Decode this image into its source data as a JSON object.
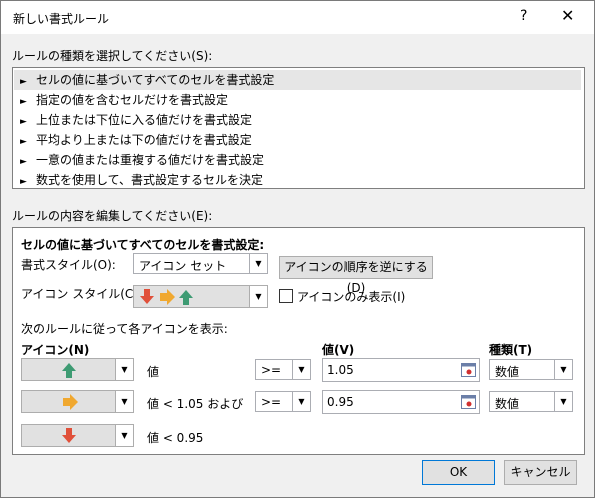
{
  "window": {
    "title": "新しい書式ルール",
    "help_glyph": "?",
    "close_glyph": "✕"
  },
  "rule_type_label": "ルールの種類を選択してください(S):",
  "rule_types": [
    "セルの値に基づいてすべてのセルを書式設定",
    "指定の値を含むセルだけを書式設定",
    "上位または下位に入る値だけを書式設定",
    "平均より上または下の値だけを書式設定",
    "一意の値または重複する値だけを書式設定",
    "数式を使用して、書式設定するセルを決定"
  ],
  "edit_label": "ルールの内容を編集してください(E):",
  "edit": {
    "heading": "セルの値に基づいてすべてのセルを書式設定:",
    "format_style_label": "書式スタイル(O):",
    "format_style_value": "アイコン セット",
    "reverse_button": "アイコンの順序を逆にする(D)",
    "icon_style_label": "アイコン スタイル(C):",
    "icon_only_label": "アイコンのみ表示(I)",
    "rules_intro": "次のルールに従って各アイコンを表示:",
    "col_icon": "アイコン(N)",
    "col_value": "値(V)",
    "col_type": "種類(T)",
    "rows": [
      {
        "icon": "green-up-arrow",
        "cond": "値",
        "op": ">=",
        "value": "1.05",
        "type": "数値"
      },
      {
        "icon": "yellow-right-arrow",
        "cond": "値 < 1.05 および",
        "op": ">=",
        "value": "0.95",
        "type": "数値"
      },
      {
        "icon": "red-down-arrow",
        "cond": "値 < 0.95"
      }
    ]
  },
  "buttons": {
    "ok": "OK",
    "cancel": "キャンセル"
  },
  "colors": {
    "selected_row": "#e6e6e6",
    "arrow_green": "#3e9b73",
    "arrow_yellow": "#f0a830",
    "arrow_red": "#e0503a",
    "ok_border": "#0078d7"
  }
}
